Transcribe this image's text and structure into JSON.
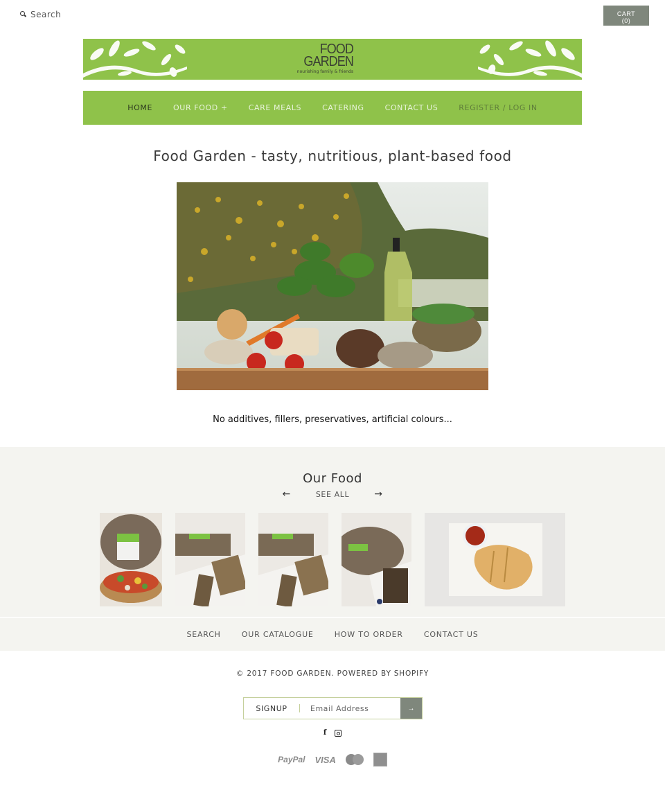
{
  "header": {
    "search_placeholder": "Search",
    "cart_label": "CART",
    "cart_count": "(0)"
  },
  "banner": {
    "logo_line1": "FOOD",
    "logo_line2": "GARDEN",
    "logo_tagline": "nourishing family & friends",
    "background_color": "#8fc24a"
  },
  "nav": {
    "items": [
      {
        "label": "HOME",
        "state": "active"
      },
      {
        "label": "OUR FOOD +",
        "state": "normal"
      },
      {
        "label": "CARE MEALS",
        "state": "normal"
      },
      {
        "label": "CATERING",
        "state": "normal"
      },
      {
        "label": "CONTACT US",
        "state": "normal"
      },
      {
        "label": "REGISTER / LOG IN",
        "state": "muted"
      }
    ]
  },
  "main": {
    "headline": "Food Garden - tasty, nutritious, plant-based food",
    "hero_image": "food-on-tray-garden-photo",
    "tagline": "No additives, fillers, preservatives, artificial colours..."
  },
  "our_food": {
    "title": "Our Food",
    "prev_icon": "arrow-left-icon",
    "next_icon": "arrow-right-icon",
    "prev_glyph": "←",
    "next_glyph": "→",
    "see_all_label": "SEE ALL",
    "products": [
      {
        "image": "bread-and-pizza-photo"
      },
      {
        "image": "seeded-loaf-slices-photo"
      },
      {
        "image": "seeded-loaf-slices-photo"
      },
      {
        "image": "seed-bar-photo"
      },
      {
        "image": "pie-with-sauce-photo"
      }
    ]
  },
  "footer": {
    "links": [
      "SEARCH",
      "OUR CATALOGUE",
      "HOW TO ORDER",
      "CONTACT US"
    ],
    "copyright": "© 2017 FOOD GARDEN. POWERED BY SHOPIFY",
    "signup_label": "SIGNUP",
    "email_placeholder": "Email Address",
    "signup_submit": "→",
    "social": [
      {
        "name": "facebook",
        "glyph": "f"
      },
      {
        "name": "instagram",
        "glyph": ""
      }
    ],
    "payments": [
      "PayPal",
      "VISA",
      "MasterCard",
      "American Express"
    ]
  }
}
